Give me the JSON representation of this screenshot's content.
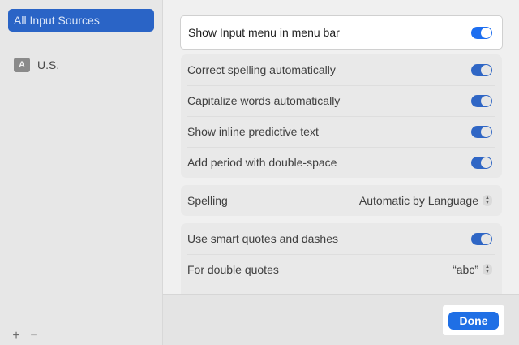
{
  "sidebar": {
    "header_label": "All Input Sources",
    "sources": [
      {
        "badge": "A",
        "label": "U.S."
      }
    ],
    "footer": {
      "add": "+",
      "remove": "−"
    }
  },
  "settings": {
    "show_input_menu": {
      "label": "Show Input menu in menu bar",
      "on": true
    },
    "toggles": [
      {
        "label": "Correct spelling automatically",
        "on": true
      },
      {
        "label": "Capitalize words automatically",
        "on": true
      },
      {
        "label": "Show inline predictive text",
        "on": true
      },
      {
        "label": "Add period with double-space",
        "on": true
      }
    ],
    "spelling": {
      "label": "Spelling",
      "value": "Automatic by Language"
    },
    "smart_quotes": {
      "label": "Use smart quotes and dashes",
      "on": true
    },
    "double_quotes": {
      "label": "For double quotes",
      "value": "“abc”"
    }
  },
  "footer": {
    "done_label": "Done"
  },
  "colors": {
    "accent": "#1f6fe5",
    "sidebar_selection": "#2a64c6"
  }
}
